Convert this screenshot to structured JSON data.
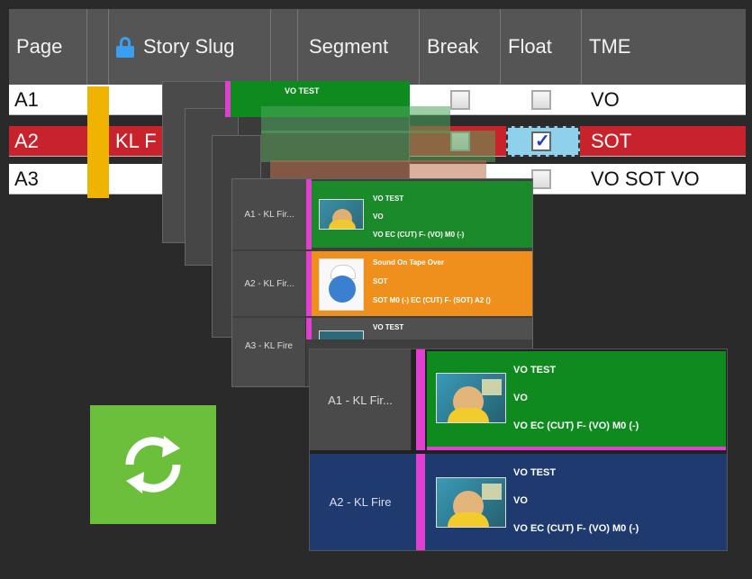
{
  "table": {
    "headers": {
      "page": "Page",
      "story_slug": "Story Slug",
      "segment": "Segment",
      "break": "Break",
      "float": "Float",
      "tme": "TME"
    },
    "rows": [
      {
        "page": "A1",
        "slug": "",
        "tme": "VO",
        "float_checked": false,
        "selected": false
      },
      {
        "page": "A2",
        "slug": "KL F",
        "tme": "SOT",
        "float_checked": true,
        "selected": true
      },
      {
        "page": "A3",
        "slug": "",
        "tme": "VO SOT VO",
        "float_checked": false,
        "selected": false
      }
    ]
  },
  "mid_cards": [
    {
      "label": "A1 - KL Fir...",
      "title": "VO TEST",
      "type": "VO",
      "detail": "VO EC (CUT) F- (VO) M0 (-)",
      "color": "#1b8a2a",
      "thumb": "woman-thumbnail"
    },
    {
      "label": "A2 - KL Fir...",
      "title": "Sound On Tape Over",
      "type": "SOT",
      "detail": "SOT M0 (-) EC (CUT) F- (SOT) A2 ()",
      "color": "#f0901c",
      "thumb": "smurf-thumbnail"
    },
    {
      "label": "A3 - KL Fire",
      "title": "VO TEST",
      "type": "",
      "detail": "",
      "color": "#1b8a2a",
      "thumb": "woman-thumbnail"
    }
  ],
  "front_cards": [
    {
      "label": "A1 - KL Fir...",
      "title": "VO TEST",
      "type": "VO",
      "detail": "VO EC (CUT) F- (VO) M0 (-)",
      "color": "#0e8a1e"
    },
    {
      "label": "A2 - KL Fire",
      "title": "VO TEST",
      "type": "VO",
      "detail": "VO EC (CUT) F- (VO) M0 (-)",
      "color": "#1e3a6e"
    }
  ],
  "back_card": {
    "title": "VO TEST"
  },
  "colors": {
    "selected_row": "#c8232c",
    "slug_marker": "#f0b400",
    "accent_pink": "#e040d0",
    "refresh_button": "#6bbf3a"
  },
  "icons": {
    "lock": "lock-icon",
    "refresh": "refresh-icon"
  }
}
